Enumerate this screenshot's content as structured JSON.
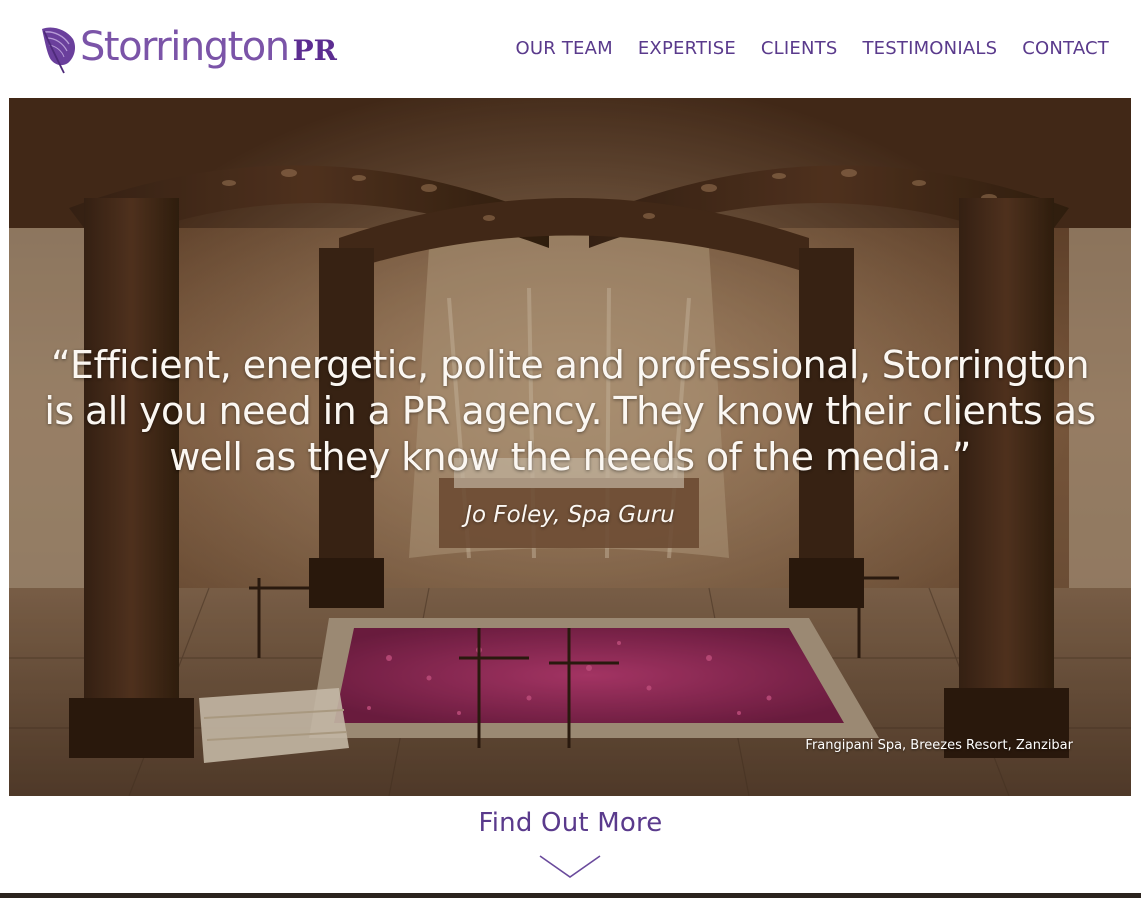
{
  "brand": {
    "name": "Storrington",
    "suffix": "PR",
    "accent_color": "#7b54a8",
    "dark_accent_color": "#5c2d91",
    "logo_icon": "feather-icon"
  },
  "nav": {
    "items": [
      {
        "label": "OUR TEAM"
      },
      {
        "label": "EXPERTISE"
      },
      {
        "label": "CLIENTS"
      },
      {
        "label": "TESTIMONIALS"
      },
      {
        "label": "CONTACT"
      }
    ]
  },
  "hero": {
    "quote_lines": [
      "“Efficient, energetic, polite and professional, Storrington",
      "is all you need in a PR agency. They know their clients as",
      "well as they know the needs of the media.”"
    ],
    "attribution": "Jo Foley, Spa Guru",
    "caption": "Frangipani Spa, Breezes Resort, Zanzibar"
  },
  "cta": {
    "label": "Find Out More",
    "icon": "chevron-down-icon"
  }
}
